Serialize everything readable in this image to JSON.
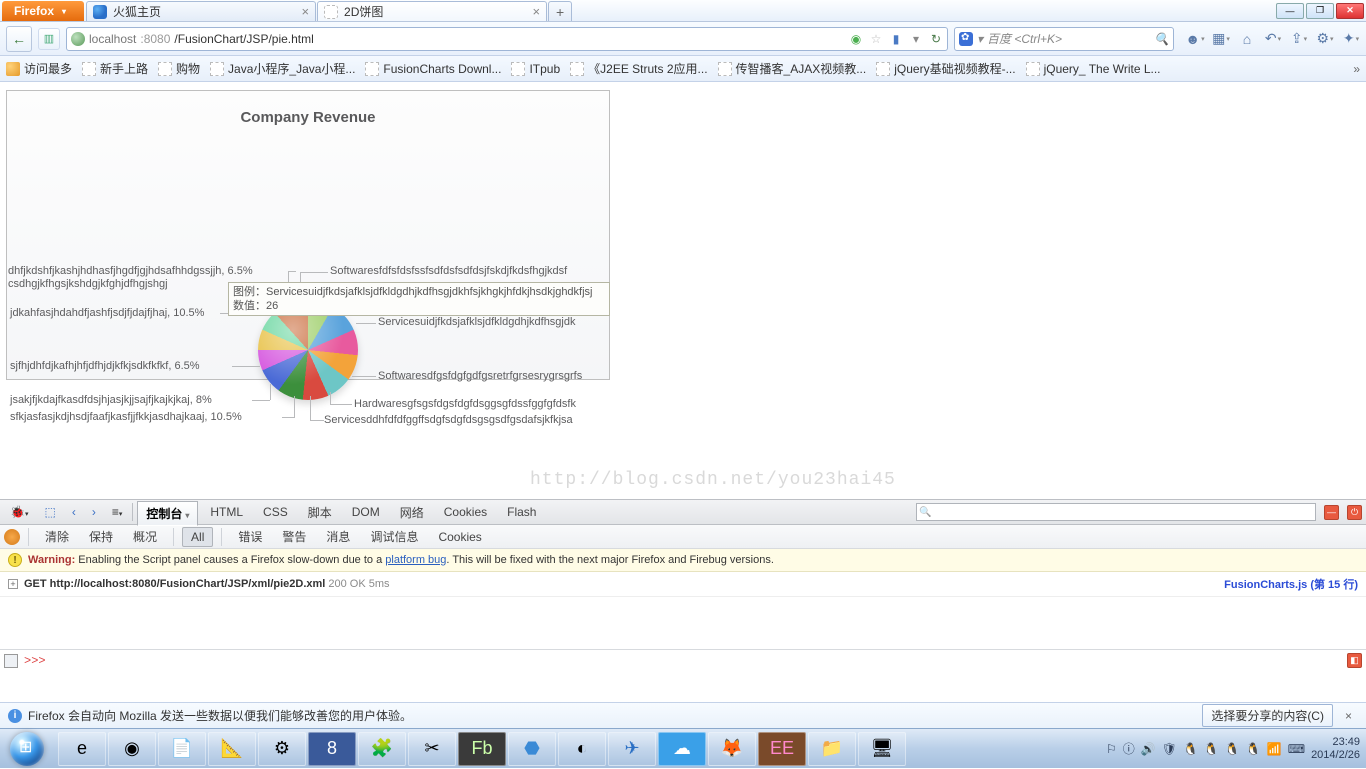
{
  "firefox_label": "Firefox",
  "tabs": [
    {
      "title": "火狐主页"
    },
    {
      "title": "2D饼图"
    }
  ],
  "url": {
    "host": "localhost",
    "port": ":8080",
    "path": "/FusionChart/JSP/pie.html"
  },
  "search_placeholder": "百度 <Ctrl+K>",
  "bookmarks": {
    "first": "访问最多",
    "items": [
      "新手上路",
      "购物",
      "Java小程序_Java小程...",
      "FusionCharts Downl...",
      "ITpub",
      "《J2EE Struts 2应用...",
      "传智播客_AJAX视频教...",
      "jQuery基础视频教程-...",
      "jQuery_ The Write L..."
    ]
  },
  "chart_data": {
    "type": "pie",
    "title": "Company Revenue",
    "tooltip": {
      "legend_label": "图例：",
      "legend_value": "Servicesuidjfkdsjafklsjdfkldgdhjkdfhsgjdkhfsjkhgkjhfdkjhsdkjghdkfjsj",
      "num_label": "数值：",
      "num_value": "26"
    },
    "slices": [
      {
        "label": "Softwaresfdfsfdsfssfsdfdsfsdfdsjfskdjfkdsfhgjkdsf",
        "percent": null
      },
      {
        "label": "Servicesuidjfkdsjafklsjdfkldgdhjkdfhsgjdk",
        "percent": null
      },
      {
        "label": "Softwaresdfgsfdgfgdfgsretrfgrsesrygrsgrfs",
        "percent": null
      },
      {
        "label": "Hardwaresgfsgsfdgsfdgfdsggsgfdssfggfgfdsfk",
        "percent": null
      },
      {
        "label": "Servicesddhfdfdfggffsdgfsdgfdsgsgsdfgsdafsjkfkjsa",
        "percent": null
      },
      {
        "label": "sfkjasfasjkdjhsdjfaafjkasfjjfkkjasdhajkaaj",
        "percent": 10.5
      },
      {
        "label": "jsakjfjkdajfkasdfdsjhjasjkjjsajfjkajkjkaj",
        "percent": 8
      },
      {
        "label": "sjfhjdhfdjkafhjhfjdfhjdjkfkjsdkfkfkf",
        "percent": 6.5
      },
      {
        "label": "jdkahfasjhdahdfjashfjsdjfjdajfjhaj",
        "percent": 10.5
      },
      {
        "label": "csdhgjkfhgsjkshdgjkfghjdfhgjshgj",
        "percent": null
      },
      {
        "label": "dhfjkdshfjkashjhdhasfjhgdfjgjhdsafhhdgssjjh",
        "percent": 6.5
      }
    ]
  },
  "labels": {
    "l0": "Softwaresfdfsfdsfssfsdfdsfsdfdsjfskdjfkdsfhgjkdsf",
    "l1": "Servicesuidjfkdsjafklsjdfkldgdhjkdfhsgjdk",
    "l2": "Softwaresdfgsfdgfgdfgsretrfgrsesrygrsgrfs",
    "l3": "Hardwaresgfsgsfdgsfdgfdsggsgfdssfggfgfdsfk",
    "l4": "Servicesddhfdfdfggffsdgfsdgfdsgsgsdfgsdafsjkfkjsa",
    "l5": "sfkjasfasjkdjhsdjfaafjkasfjjfkkjasdhajkaaj, 10.5%",
    "l6": "jsakjfjkdajfkasdfdsjhjasjkjjsajfjkajkjkaj, 8%",
    "l7": "sjfhjdhfdjkafhjhfjdfhjdjkfkjsdkfkfkf, 6.5%",
    "l8": "jdkahfasjhdahdfjashfjsdjfjdajfjhaj, 10.5%",
    "l9": "csdhgjkfhgsjkshdgjkfghjdfhgjshgj",
    "l10": "dhfjkdshfjkashjhdhasfjhgdfjgjhdsafhhdgssjjh, 6.5%"
  },
  "watermark": "http://blog.csdn.net/you23hai45",
  "devtools": {
    "tabs": [
      "控制台",
      "HTML",
      "CSS",
      "脚本",
      "DOM",
      "网络",
      "Cookies",
      "Flash"
    ],
    "subtabs_left": [
      "清除",
      "保持",
      "概况"
    ],
    "subtab_all": "All",
    "subtabs_right": [
      "错误",
      "警告",
      "消息",
      "调试信息",
      "Cookies"
    ],
    "warning_label": "Warning:",
    "warning_text_a": " Enabling the Script panel causes a Firefox slow-down due to a ",
    "warning_link": "platform bug",
    "warning_text_b": ". This will be fixed with the next major Firefox and Firebug versions.",
    "log_method": "GET ",
    "log_url": "http://localhost:8080/FusionChart/JSP/xml/pie2D.xml",
    "log_status": "  200 OK  5ms",
    "log_src": "FusionCharts.js",
    "log_line": " (第 15 行)",
    "prompt": ">>>"
  },
  "infobar": {
    "text": "Firefox 会自动向 Mozilla 发送一些数据以便我们能够改善您的用户体验。",
    "button": "选择要分享的内容(C)"
  },
  "clock": {
    "time": "23:49",
    "date": "2014/2/26"
  }
}
